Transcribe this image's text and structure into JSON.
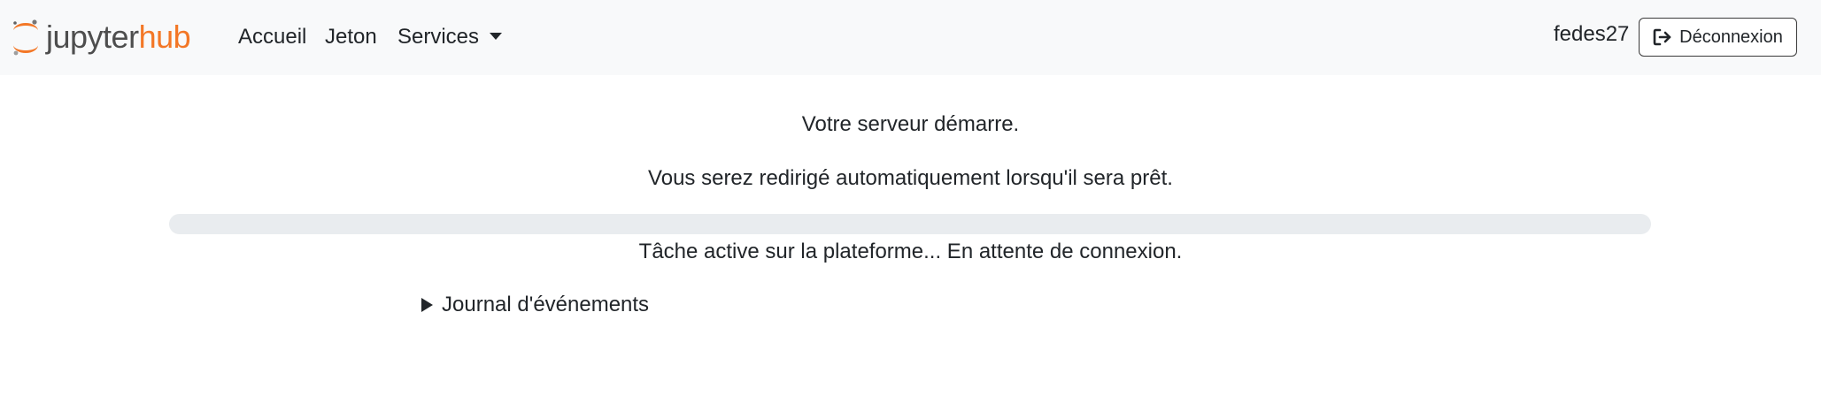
{
  "navbar": {
    "brand": {
      "name_part1": "jupyter",
      "name_part2": "hub",
      "logo_icon": "jupyter-logo-icon"
    },
    "links": [
      {
        "label": "Accueil"
      },
      {
        "label": "Jeton"
      },
      {
        "label": "Services",
        "has_dropdown": true
      }
    ],
    "user": {
      "name": "fedes27"
    },
    "logout": {
      "label": "Déconnexion",
      "icon": "sign-out-icon"
    }
  },
  "main": {
    "status_title": "Votre serveur démarre.",
    "status_subtitle": "Vous serez redirigé automatiquement lorsqu'il sera prêt.",
    "progress": {
      "value_percent": 0
    },
    "progress_message": "Tâche active sur la plateforme... En attente de connexion.",
    "event_log_label": "Journal d'événements"
  },
  "colors": {
    "brand_orange": "#f37726",
    "brand_gray": "#4e4e4e",
    "navbar_bg": "#f8f9fa",
    "progress_track": "#e9ecef"
  }
}
